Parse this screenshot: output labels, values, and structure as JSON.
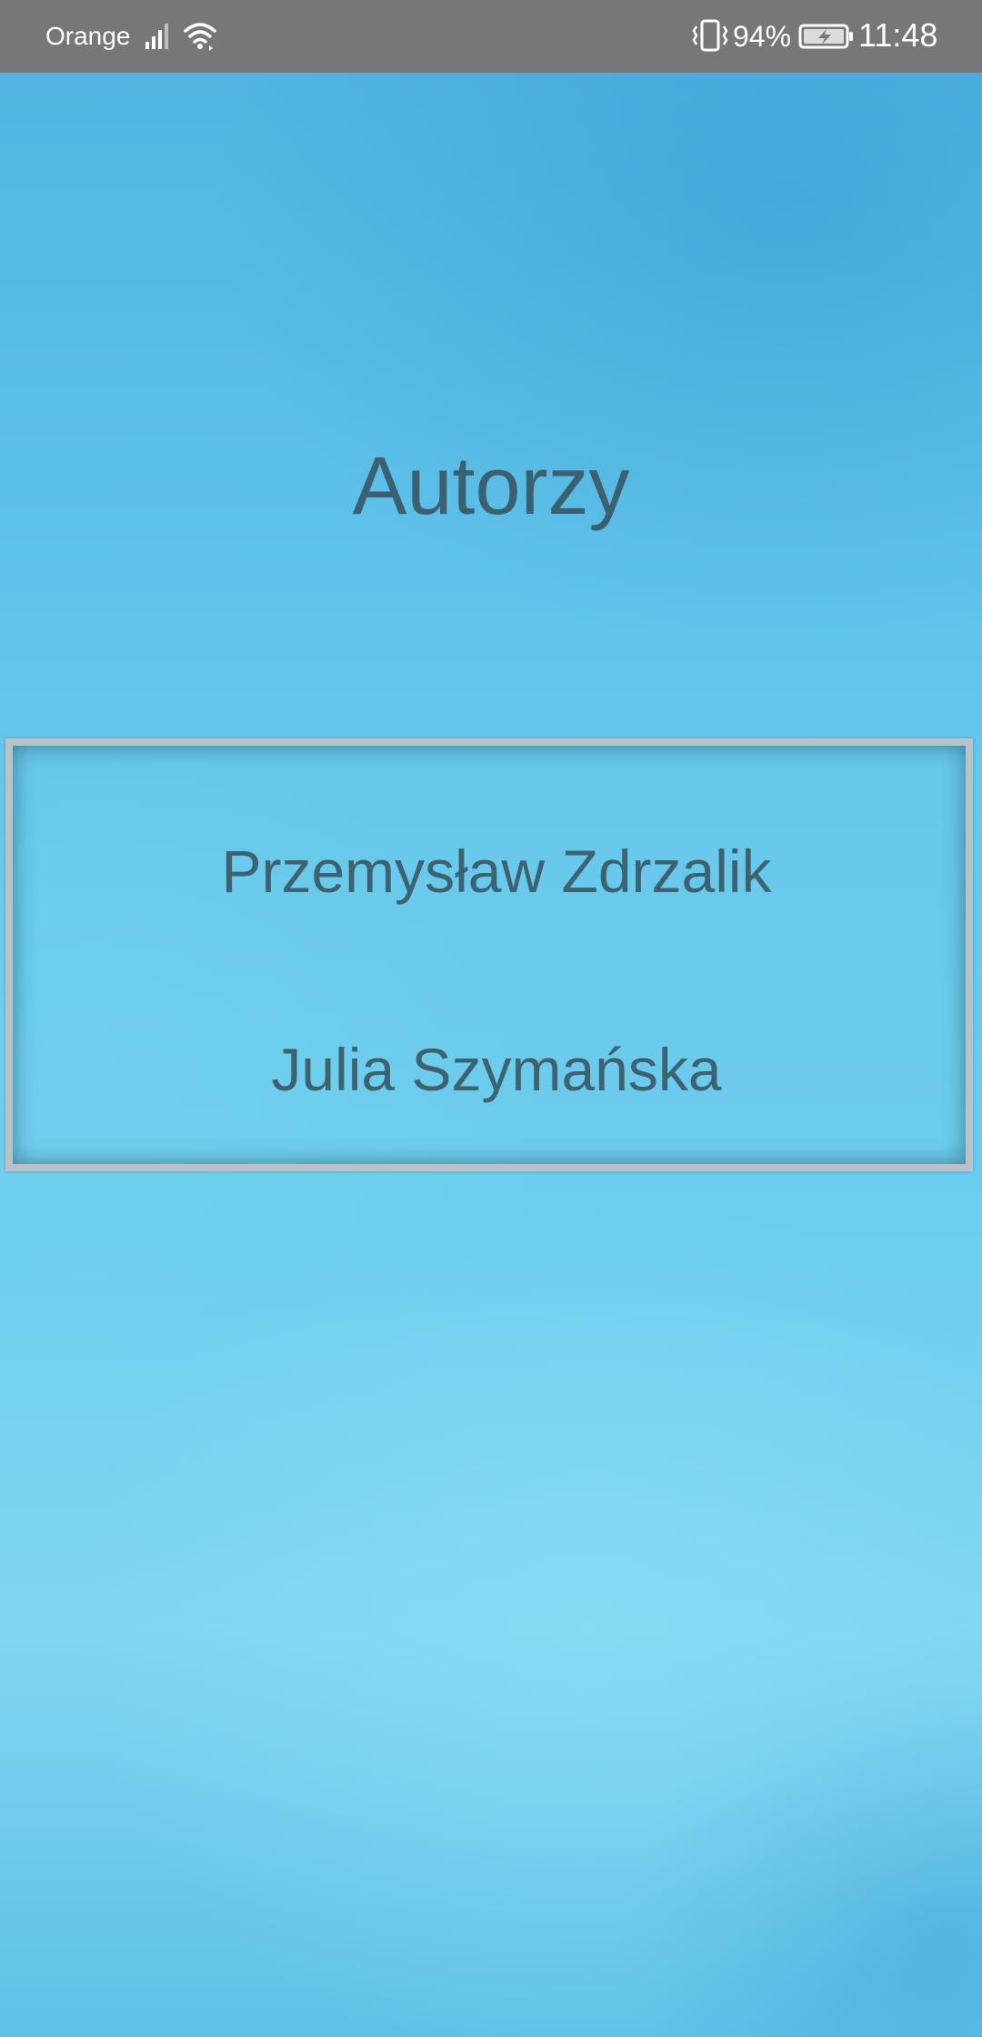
{
  "status_bar": {
    "carrier": "Orange",
    "battery_percent": "94%",
    "time": "11:48",
    "icons": [
      "signal-icon",
      "wifi-icon",
      "vibrate-icon",
      "battery-charging-icon"
    ],
    "background_color": "#777777"
  },
  "page": {
    "title": "Autorzy",
    "authors": [
      "Przemysław Zdrzalik",
      "Julia Szymańska"
    ],
    "text_color": "#3b6070",
    "background_color": "#5cc3e8"
  }
}
